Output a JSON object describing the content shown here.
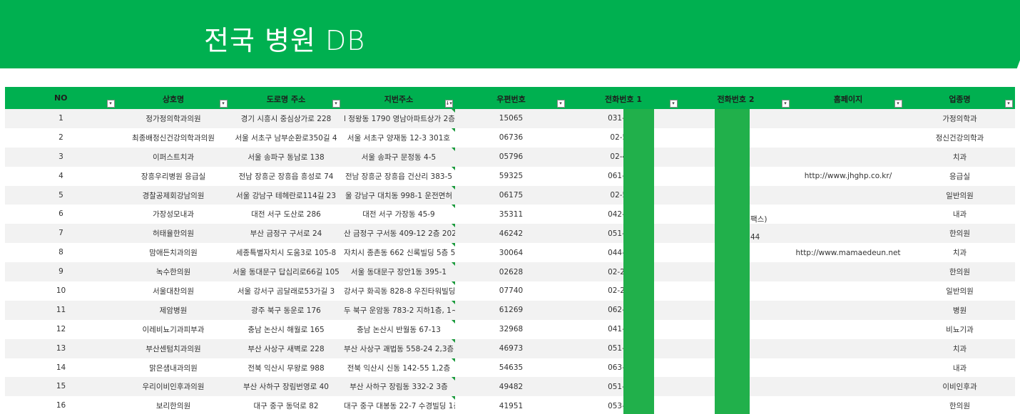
{
  "title": "전국 병원 DB",
  "headers": [
    {
      "label": "NO",
      "filter": "▾"
    },
    {
      "label": "상호명",
      "filter": "▾"
    },
    {
      "label": "도로명 주소",
      "filter": "▾"
    },
    {
      "label": "지번주소",
      "filter": "↓▾"
    },
    {
      "label": "우편번호",
      "filter": "▾"
    },
    {
      "label": "전화번호 1",
      "filter": "▾"
    },
    {
      "label": "전화번호 2",
      "filter": "▾"
    },
    {
      "label": "홈페이지",
      "filter": "▾"
    },
    {
      "label": "업종명",
      "filter": "▾"
    }
  ],
  "rows": [
    {
      "no": "1",
      "name": "정가정의학과의원",
      "road": "경기 시흥시 중심상가로 228",
      "jibun": "l 정왕동 1790 영남아파트상가 2층",
      "zip": "15065",
      "phone1": "031-319",
      "phone2": "",
      "homepage": "",
      "category": "가정의학과"
    },
    {
      "no": "2",
      "name": "최종배정신건강의학과의원",
      "road": "서울 서초구 남부순환로350길 4",
      "jibun": "서울 서초구 양재동 12-3 301호",
      "zip": "06736",
      "phone1": "02-574",
      "phone2": "",
      "homepage": "",
      "category": "정신건강의학과"
    },
    {
      "no": "3",
      "name": "이퍼스트치과",
      "road": "서울 송파구 동남로 138",
      "jibun": "서울 송파구 문정동 4-5",
      "zip": "05796",
      "phone1": "02-403",
      "phone2": "",
      "homepage": "",
      "category": "치과"
    },
    {
      "no": "4",
      "name": "장흥우리병원 응급실",
      "road": "전남 장흥군 장흥읍 흥성로 74",
      "jibun": "전남 장흥군 장흥읍 건산리 383-5",
      "zip": "59325",
      "phone1": "061-860",
      "phone2": "",
      "homepage": "http://www.jhghp.co.kr/",
      "category": "응급실"
    },
    {
      "no": "5",
      "name": "경찰공제회강남의원",
      "road": "서울 강남구 테헤란로114길 23",
      "jibun": "울 강남구 대치동 998-1 운전면허",
      "zip": "06175",
      "phone1": "02-556",
      "phone2": "",
      "homepage": "",
      "category": "일반의원"
    },
    {
      "no": "6",
      "name": "가장성모내과",
      "road": "대전 서구 도산로 286",
      "jibun": "대전 서구 가장동 45-9",
      "zip": "35311",
      "phone1": "042-538",
      "phone2": "042-",
      "homepage": "",
      "category": "내과"
    },
    {
      "no": "7",
      "name": "허태율한의원",
      "road": "부산 금정구 구서로 24",
      "jibun": "산 금정구 구서동 409-12 2층 202",
      "zip": "46242",
      "phone1": "051-513",
      "phone2": "0",
      "homepage": "",
      "category": "한의원"
    },
    {
      "no": "8",
      "name": "맘애든치과의원",
      "road": "세종특별자치시 도움3로 105-8",
      "jibun": "자치시 종촌동 662 신록빌딩 5층 5",
      "zip": "30064",
      "phone1": "044-862",
      "phone2": "",
      "homepage": "http://www.mamaedeun.net",
      "category": "치과"
    },
    {
      "no": "9",
      "name": "녹수한의원",
      "road": "서울 동대문구 답십리로66길 105",
      "jibun": "서울 동대문구 장안1동 395-1",
      "zip": "02628",
      "phone1": "02-2248",
      "phone2": "",
      "homepage": "",
      "category": "한의원"
    },
    {
      "no": "10",
      "name": "서울대찬의원",
      "road": "서울 강서구 곰달래로53가길 3",
      "jibun": "강서구 화곡동 828-8 우진타워빌딩",
      "zip": "07740",
      "phone1": "02-2646",
      "phone2": "",
      "homepage": "",
      "category": "일반의원"
    },
    {
      "no": "11",
      "name": "제암병원",
      "road": "광주 북구 동운로 176",
      "jibun": "두 북구 운암동 783-2 지하1층, 1~",
      "zip": "61269",
      "phone1": "062-528",
      "phone2": "",
      "homepage": "",
      "category": "병원"
    },
    {
      "no": "12",
      "name": "이레비뇨기과피부과",
      "road": "충남 논산시 해월로 165",
      "jibun": "충남 논산시 반월동 67-13",
      "zip": "32968",
      "phone1": "041-733",
      "phone2": "",
      "homepage": "",
      "category": "비뇨기과"
    },
    {
      "no": "13",
      "name": "부산센텀치과의원",
      "road": "부산 사상구 새벽로 228",
      "jibun": "부산 사상구 괘법동 558-24 2,3층",
      "zip": "46973",
      "phone1": "051-322",
      "phone2": "",
      "homepage": "",
      "category": "치과"
    },
    {
      "no": "14",
      "name": "맑은샘내과의원",
      "road": "전북 익산시 무왕로 988",
      "jibun": "전북 익산시 신동 142-55 1,2층",
      "zip": "54635",
      "phone1": "063-838",
      "phone2": "",
      "homepage": "",
      "category": "내과"
    },
    {
      "no": "15",
      "name": "우리이비인후과의원",
      "road": "부산 사하구 장림번영로 40",
      "jibun": "부산 사하구 장림동 332-2 3층",
      "zip": "49482",
      "phone1": "051-265",
      "phone2": "",
      "homepage": "",
      "category": "이비인후과"
    },
    {
      "no": "16",
      "name": "보리한의원",
      "road": "대구 중구 동덕로 82",
      "jibun": "대구 중구 대봉동 22-7 수경빌딩 1층",
      "zip": "41951",
      "phone1": "053-292",
      "phone2": "",
      "homepage": "",
      "category": "한의원"
    }
  ],
  "overlays": {
    "row6_phone2_tail": "팩스)",
    "row7_phone2_tail": "44"
  },
  "colors": {
    "banner": "#00b050",
    "header": "#00b050",
    "redaction": "#21b04b",
    "stripe": "#f2f2f2"
  }
}
